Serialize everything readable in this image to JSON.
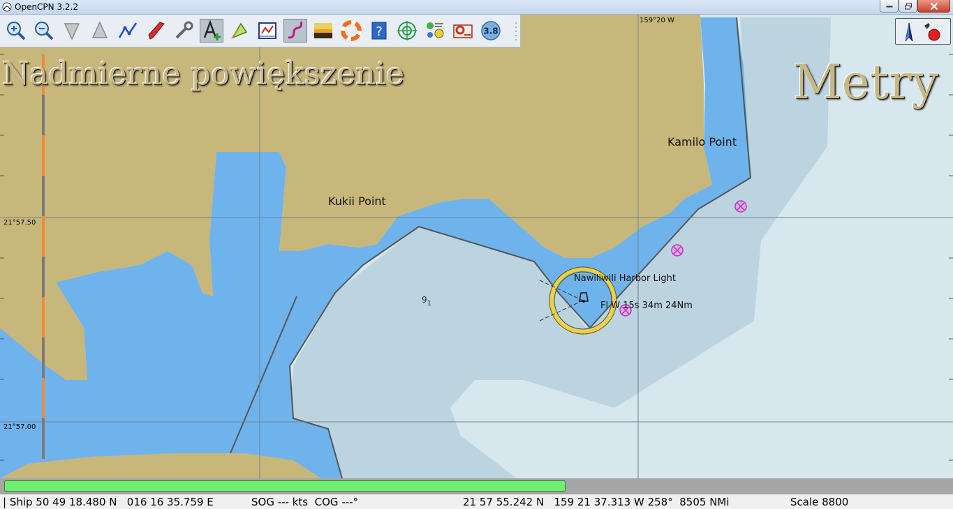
{
  "window": {
    "title": "OpenCPN 3.2.2"
  },
  "toolbar": {
    "tools": [
      {
        "name": "zoom-in-icon"
      },
      {
        "name": "zoom-out-icon"
      },
      {
        "name": "scale-in-icon"
      },
      {
        "name": "scale-out-icon"
      },
      {
        "name": "create-route-icon"
      },
      {
        "name": "auto-follow-icon"
      },
      {
        "name": "settings-icon"
      },
      {
        "name": "text-icon"
      },
      {
        "name": "current-tide-icon"
      },
      {
        "name": "route-manager-icon"
      },
      {
        "name": "track-icon"
      },
      {
        "name": "color-scheme-icon"
      },
      {
        "name": "mob-icon"
      },
      {
        "name": "help-icon"
      },
      {
        "name": "radar-icon"
      },
      {
        "name": "ais-icon"
      },
      {
        "name": "print-icon"
      },
      {
        "name": "zoom-badge-icon",
        "label": "3.8"
      }
    ]
  },
  "map": {
    "overlay_left": "Nadmierne powiększenie",
    "overlay_right": "Metry",
    "longitude_label": "159°20 W",
    "lat_label_top": "21°57.50",
    "lat_label_bottom": "21°57.00",
    "place_kamilo": "Kamilo Point",
    "place_kukii": "Kukii Point",
    "light_name": "Nawiliwili Harbor Light",
    "light_char": "Fl W 15s 34m 24Nm",
    "sounding_main": "9",
    "sounding_sub": "1",
    "colors": {
      "land": "#c8b77a",
      "shallow_water": "#6fb3ec",
      "medium_water": "#bcd3e0",
      "deep_water": "#d6e8ee",
      "grid": "#6f8390"
    }
  },
  "progress": {
    "fraction": 0.594,
    "color": "#6ef06e"
  },
  "status": {
    "ship": "| Ship 50 49 18.480 N   016 16 35.759 E",
    "sog_cog": "SOG --- kts  COG ---°",
    "cursor": "21 57 55.242 N   159 21 37.313 W 258°  8505 NMi",
    "scale": "Scale 8800"
  }
}
